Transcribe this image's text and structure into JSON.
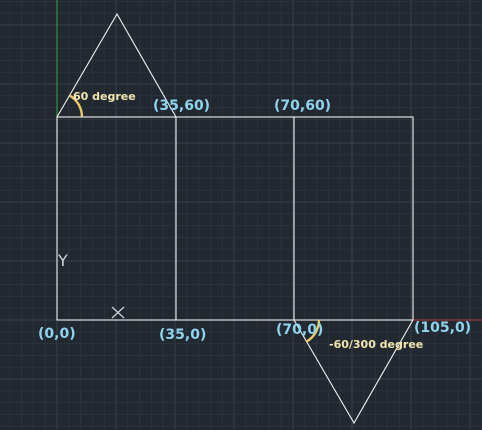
{
  "points": {
    "origin": "(0,0)",
    "p35_0": "(35,0)",
    "p70_0": "(70,0)",
    "p105_0": "(105,0)",
    "p35_60": "(35,60)",
    "p70_60": "(70,60)"
  },
  "angles": {
    "top_left": "60 degree",
    "bottom_right": "-60/300 degree"
  },
  "ucs": {
    "y_axis_label": "Y"
  },
  "colors": {
    "background": "#212830",
    "grid_minor": "#2b333c",
    "grid_major": "#36404a",
    "lines": "#f2f2f2",
    "point_labels": "#8fd3ee",
    "angle_labels": "#f3e6b0",
    "angle_arcs": "#e9c96a",
    "axis_x": "#b23a3a",
    "axis_y": "#2fa84a"
  }
}
